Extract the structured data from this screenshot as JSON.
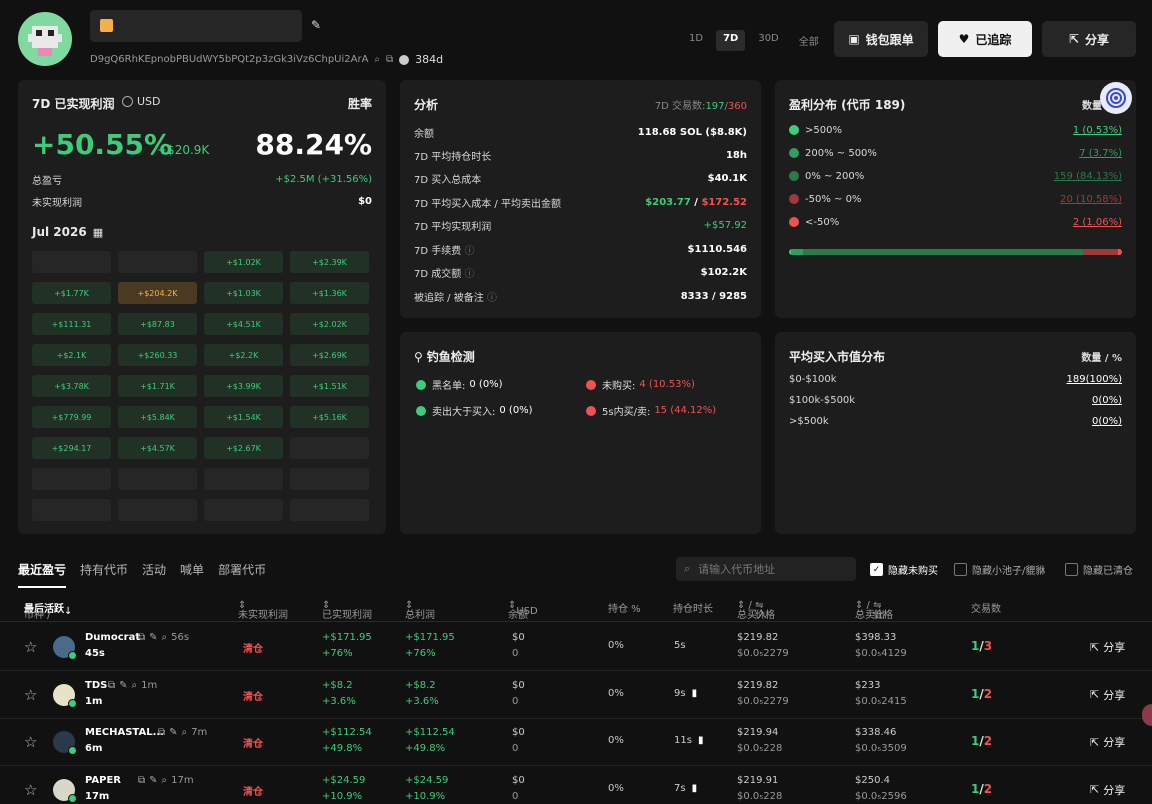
{
  "header": {
    "address": "D9gQ6RhKEpnobPBUdWY5bPQt2p3zGk3iVz6ChpUi2ArA",
    "age": "384d",
    "timeframes": [
      "1D",
      "7D",
      "30D",
      "全部"
    ],
    "copy_trade_label": "钱包跟单",
    "tracked_label": "已追踪",
    "share_label": "分享"
  },
  "pnl_card": {
    "title": "7D 已实现利润",
    "currency": "USD",
    "winrate_label": "胜率",
    "pnl_pct": "+50.55%",
    "pnl_usd": "+$20.9K",
    "winrate": "88.24%",
    "total_label": "总盈亏",
    "total_value": "+$2.5M (+31.56%)",
    "unrealized_label": "未实现利润",
    "unrealized_value": "$0",
    "month": "Jul 2026",
    "calendar": [
      [
        "",
        "",
        "+$1.02K",
        "+$2.39K"
      ],
      [
        "+$1.77K",
        "+$204.2K",
        "+$1.03K",
        "+$1.36K"
      ],
      [
        "+$111.31",
        "+$87.83",
        "+$4.51K",
        "+$2.02K"
      ],
      [
        "+$2.1K",
        "+$260.33",
        "+$2.2K",
        "+$2.69K"
      ],
      [
        "+$3.78K",
        "+$1.71K",
        "+$3.99K",
        "+$1.51K"
      ],
      [
        "+$779.99",
        "+$5.84K",
        "+$1.54K",
        "+$5.16K"
      ],
      [
        "+$294.17",
        "+$4.57K",
        "+$2.67K",
        ""
      ],
      [
        "",
        "",
        "",
        ""
      ],
      [
        "",
        "",
        "",
        ""
      ]
    ]
  },
  "analysis": {
    "title": "分析",
    "tx_label": "7D 交易数:",
    "tx_buy": "197",
    "tx_sell": "360",
    "rows": [
      {
        "label": "余额",
        "value": "118.68 SOL ($8.8K)"
      },
      {
        "label": "7D 平均持仓时长",
        "value": "18h"
      },
      {
        "label": "7D 买入总成本",
        "value": "$40.1K"
      },
      {
        "label": "7D 平均买入成本 / 平均卖出金额",
        "value_buy": "$203.77",
        "value_sell": "$172.52"
      },
      {
        "label": "7D 平均实现利润",
        "value": "+$57.92"
      },
      {
        "label": "7D 手续费",
        "value": "$1110.546"
      },
      {
        "label": "7D 成交额",
        "value": "$102.2K"
      },
      {
        "label": "被追踪 / 被备注",
        "value": "8333 / 9285"
      }
    ]
  },
  "distribution": {
    "title": "盈利分布 (代币 189)",
    "count_label": "数量",
    "rows": [
      {
        "label": ">500%",
        "value": "1 (0.53%)",
        "color": "#3dcc7a"
      },
      {
        "label": "200% ~ 500%",
        "value": "7 (3.7%)",
        "color": "#2f9e5e"
      },
      {
        "label": "0% ~ 200%",
        "value": "159 (84.13%)",
        "color": "#2a7a4a"
      },
      {
        "label": "-50% ~ 0%",
        "value": "20 (10.58%)",
        "color": "#a03a38"
      },
      {
        "label": "<-50%",
        "value": "2 (1.06%)",
        "color": "#ef5350"
      }
    ],
    "bar_fractions": [
      0.0053,
      0.037,
      0.8413,
      0.1058,
      0.0106
    ]
  },
  "phishing": {
    "title": "钓鱼检测",
    "items": [
      {
        "label": "黑名单:",
        "value": "0 (0%)",
        "color": "#3dcc7a",
        "valcolor": "#ffffff"
      },
      {
        "label": "未购买:",
        "value": "4 (10.53%)",
        "color": "#ef5350",
        "valcolor": "#ef5350"
      },
      {
        "label": "卖出大于买入:",
        "value": "0 (0%)",
        "color": "#3dcc7a",
        "valcolor": "#ffffff"
      },
      {
        "label": "5s内买/卖:",
        "value": "15 (44.12%)",
        "color": "#ef5350",
        "valcolor": "#ef5350"
      }
    ]
  },
  "mcap": {
    "title": "平均买入市值分布",
    "count_label": "数量 / %",
    "rows": [
      {
        "label": "$0-$100k",
        "value": "189(100%)"
      },
      {
        "label": "$100k-$500k",
        "value": "0(0%)"
      },
      {
        "label": ">$500k",
        "value": "0(0%)"
      }
    ]
  },
  "tabs": [
    "最近盈亏",
    "持有代币",
    "活动",
    "喊单",
    "部署代币"
  ],
  "search_placeholder": "请输入代币地址",
  "filters": [
    "隐藏未购买",
    "隐藏小池子/貔貅",
    "隐藏已清仓"
  ],
  "table": {
    "headers": {
      "coin": "币种 /",
      "last_active": "最后活跃",
      "unrealized": "未实现利润",
      "realized": "已实现利润",
      "total": "总利润",
      "balance": "余额",
      "usd": "USD",
      "position": "持仓 %",
      "hold": "持仓时长",
      "bought": "总买入",
      "sold": "总卖出",
      "price": "价格",
      "tx": "交易数"
    },
    "rows": [
      {
        "name": "Dumocrat",
        "age": "56s",
        "last": "45s",
        "status": "清仓",
        "realized": "+$171.95",
        "realized_pct": "+76%",
        "total": "+$171.95",
        "total_pct": "+76%",
        "bal": "$0",
        "bal2": "0",
        "pos": "0%",
        "hold": "5s",
        "buy": "$219.82",
        "buy_price": "$0.0₅2279",
        "sell": "$398.33",
        "sell_price": "$0.0₅4129",
        "tx_buy": "1",
        "tx_sell": "3",
        "share": "分享",
        "avatar": "#4a6a8a"
      },
      {
        "name": "TDS",
        "age": "1m",
        "last": "1m",
        "status": "清仓",
        "realized": "+$8.2",
        "realized_pct": "+3.6%",
        "total": "+$8.2",
        "total_pct": "+3.6%",
        "bal": "$0",
        "bal2": "0",
        "pos": "0%",
        "hold": "9s",
        "buy": "$219.82",
        "buy_price": "$0.0₅2279",
        "sell": "$233",
        "sell_price": "$0.0₅2415",
        "tx_buy": "1",
        "tx_sell": "2",
        "share": "分享",
        "avatar": "#e8e2c8"
      },
      {
        "name": "MECHASTAL...",
        "age": "7m",
        "last": "6m",
        "status": "清仓",
        "realized": "+$112.54",
        "realized_pct": "+49.8%",
        "total": "+$112.54",
        "total_pct": "+49.8%",
        "bal": "$0",
        "bal2": "0",
        "pos": "0%",
        "hold": "11s",
        "buy": "$219.94",
        "buy_price": "$0.0₅228",
        "sell": "$338.46",
        "sell_price": "$0.0₅3509",
        "tx_buy": "1",
        "tx_sell": "2",
        "share": "分享",
        "avatar": "#2a3a4a"
      },
      {
        "name": "PAPER",
        "age": "17m",
        "last": "17m",
        "status": "清仓",
        "realized": "+$24.59",
        "realized_pct": "+10.9%",
        "total": "+$24.59",
        "total_pct": "+10.9%",
        "bal": "$0",
        "bal2": "0",
        "pos": "0%",
        "hold": "7s",
        "buy": "$219.91",
        "buy_price": "$0.0₅228",
        "sell": "$250.4",
        "sell_price": "$0.0₅2596",
        "tx_buy": "1",
        "tx_sell": "2",
        "share": "分享",
        "avatar": "#d8d8c8"
      }
    ]
  }
}
